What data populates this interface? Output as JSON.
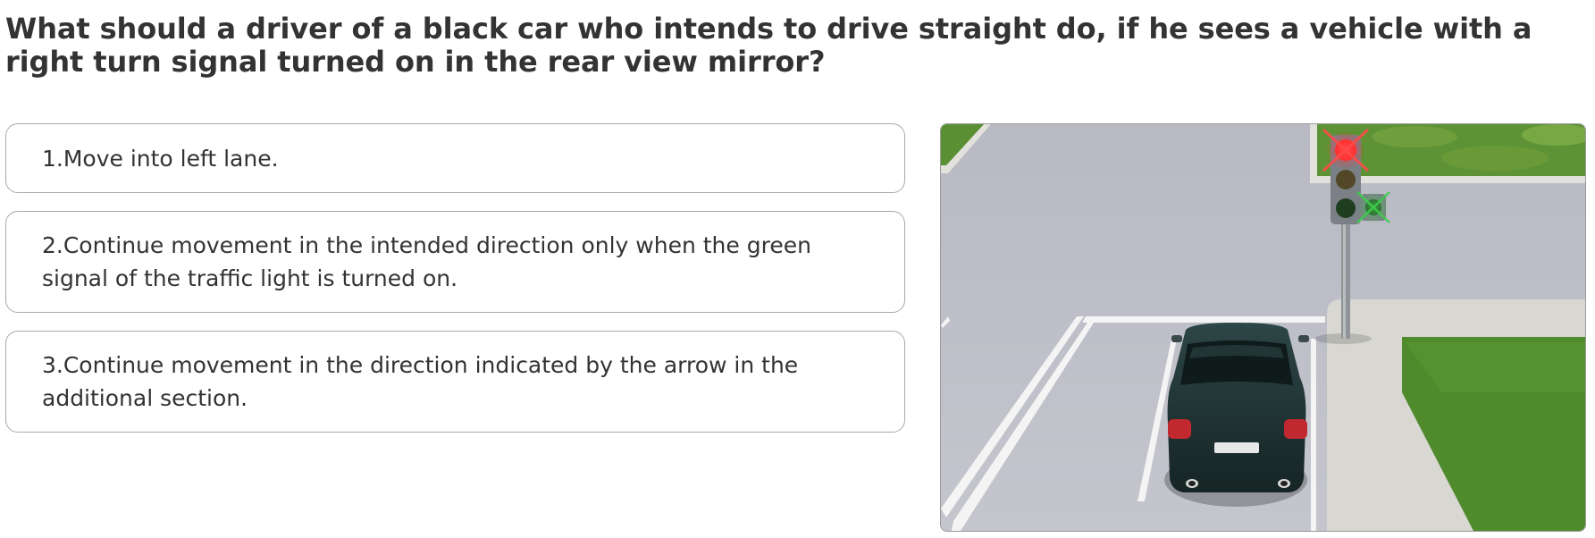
{
  "question": {
    "text": "What should a driver of a black car who intends to drive straight do, if he sees a vehicle with a right turn signal turned on in the rear view mirror?"
  },
  "answers": [
    {
      "label": "1.Move into left lane."
    },
    {
      "label": "2.Continue movement in the intended direction only when the green signal of the traffic light is turned on."
    },
    {
      "label": "3.Continue movement in the direction indicated by the arrow in the additional section."
    }
  ],
  "scene": {
    "traffic_light": {
      "main_signal": "red",
      "additional_section_signal": "off"
    },
    "colors": {
      "asphalt": "#bdbec7",
      "grass": "#4f8a2c",
      "sidewalk": "#d9d8d2",
      "car_body": "#243a3a",
      "red_signal": "#ff2a2a"
    }
  }
}
